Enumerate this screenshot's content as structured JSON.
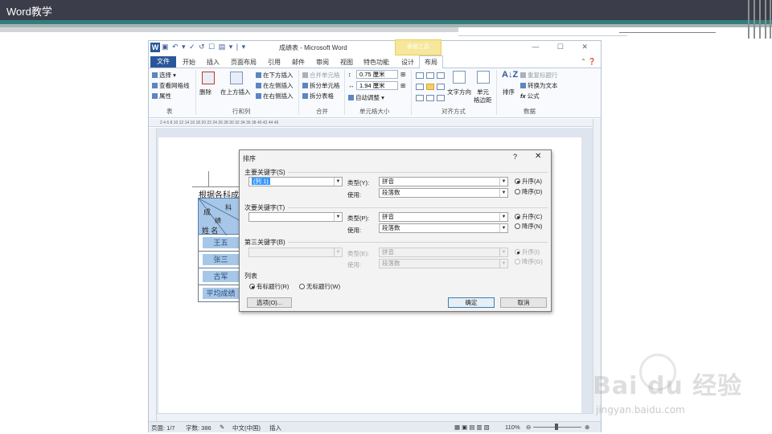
{
  "slide": {
    "title": "Word教学"
  },
  "word": {
    "window_title": "成绩表 - Microsoft Word",
    "context_tab": "表格工具",
    "window_controls": "— ☐ ✕",
    "tabs": {
      "file": "文件",
      "items": [
        "开始",
        "插入",
        "页面布局",
        "引用",
        "邮件",
        "审阅",
        "视图",
        "特色功能",
        "设计"
      ],
      "active": "布局"
    },
    "ribbon": {
      "table": {
        "select": "选择",
        "gridlines": "查看网格线",
        "properties": "属性",
        "group": "表"
      },
      "rows_cols": {
        "delete": "删除",
        "insert_above": "在上方插入",
        "insert_below": "在下方插入",
        "insert_left": "在左侧插入",
        "insert_right": "在右侧插入",
        "group": "行和列"
      },
      "merge": {
        "merge_cells": "合并单元格",
        "split_cells": "拆分单元格",
        "split_table": "拆分表格",
        "group": "合并"
      },
      "cell_size": {
        "height": "0.75 厘米",
        "width": "1.94 厘米",
        "autofit": "自动调整",
        "group": "单元格大小"
      },
      "alignment": {
        "text_direction": "文字方向",
        "cell_margins_1": "单元",
        "cell_margins_2": "格边距",
        "group": "对齐方式"
      },
      "data": {
        "sort": "排序",
        "repeat_header": "重复标题行",
        "convert_text": "转换为文本",
        "formula": "公式",
        "group": "数据"
      }
    },
    "ruler": "2  4  6  8  10  12  14  16  18  20  22  24  26  28  30  32  34  36  38  40  42  44  46",
    "document": {
      "heading": "根据各科成绩",
      "table_header": {
        "cheng": "成",
        "ke": "科",
        "ji": "绩",
        "xingming": "姓 名"
      },
      "rows": [
        "王五",
        "张三",
        "古军",
        "平均成绩"
      ]
    },
    "status": {
      "page": "页面: 1/7",
      "words": "字数: 386",
      "language": "中文(中国)",
      "mode": "插入",
      "zoom": "110%"
    }
  },
  "sort_dialog": {
    "title": "排序",
    "help": "?",
    "close": "✕",
    "primary": {
      "label": "主要关键字(S)",
      "key": "(列 1)",
      "type_label": "类型(Y):",
      "type": "拼音",
      "using_label": "使用:",
      "using": "段落数",
      "asc": "升序(A)",
      "desc": "降序(D)",
      "selected": "asc"
    },
    "secondary": {
      "label": "次要关键字(T)",
      "key": "",
      "type_label": "类型(P):",
      "type": "拼音",
      "using_label": "使用:",
      "using": "段落数",
      "asc": "升序(C)",
      "desc": "降序(N)",
      "selected": "asc"
    },
    "tertiary": {
      "label": "第三关键字(B)",
      "key": "",
      "type_label": "类型(E):",
      "type": "拼音",
      "using_label": "使用:",
      "using": "段落数",
      "asc": "升序(I)",
      "desc": "降序(G)",
      "selected": "asc"
    },
    "list": {
      "label": "列表",
      "has_header": "有标题行(R)",
      "no_header": "无标题行(W)",
      "selected": "has_header"
    },
    "options_button": "选项(O)...",
    "ok_button": "确定",
    "cancel_button": "取消"
  },
  "watermark": {
    "brand": "Bai du 经验",
    "url": "jingyan.baidu.com"
  }
}
